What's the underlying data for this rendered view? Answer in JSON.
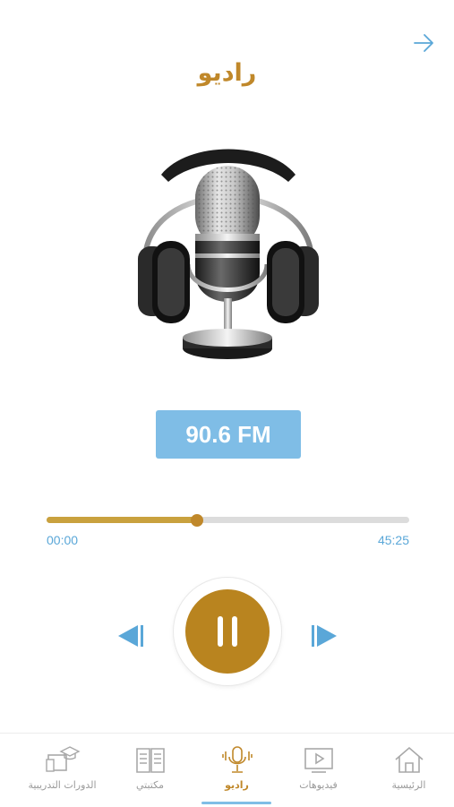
{
  "header": {
    "title": "راديو",
    "back_icon": "arrow-right-icon"
  },
  "station": {
    "frequency": "90.6 FM"
  },
  "player": {
    "current_time": "00:00",
    "duration": "45:25",
    "progress_fraction": 0.415,
    "state": "playing",
    "controls": {
      "previous_icon": "skip-previous-icon",
      "toggle_icon": "pause-icon",
      "next_icon": "skip-next-icon"
    }
  },
  "tabbar": {
    "active": "radio",
    "items": [
      {
        "id": "home",
        "label": "الرئيسية",
        "icon": "home-icon"
      },
      {
        "id": "videos",
        "label": "فيديوهات",
        "icon": "video-icon"
      },
      {
        "id": "radio",
        "label": "راديو",
        "icon": "podcast-mic-icon"
      },
      {
        "id": "library",
        "label": "مكتبتي",
        "icon": "book-icon"
      },
      {
        "id": "courses",
        "label": "الدورات التدريبية",
        "icon": "graduation-cap-icon"
      }
    ]
  },
  "colors": {
    "accent": "#c0882a",
    "blue": "#7fbde6",
    "link_blue": "#5aa7d8"
  }
}
